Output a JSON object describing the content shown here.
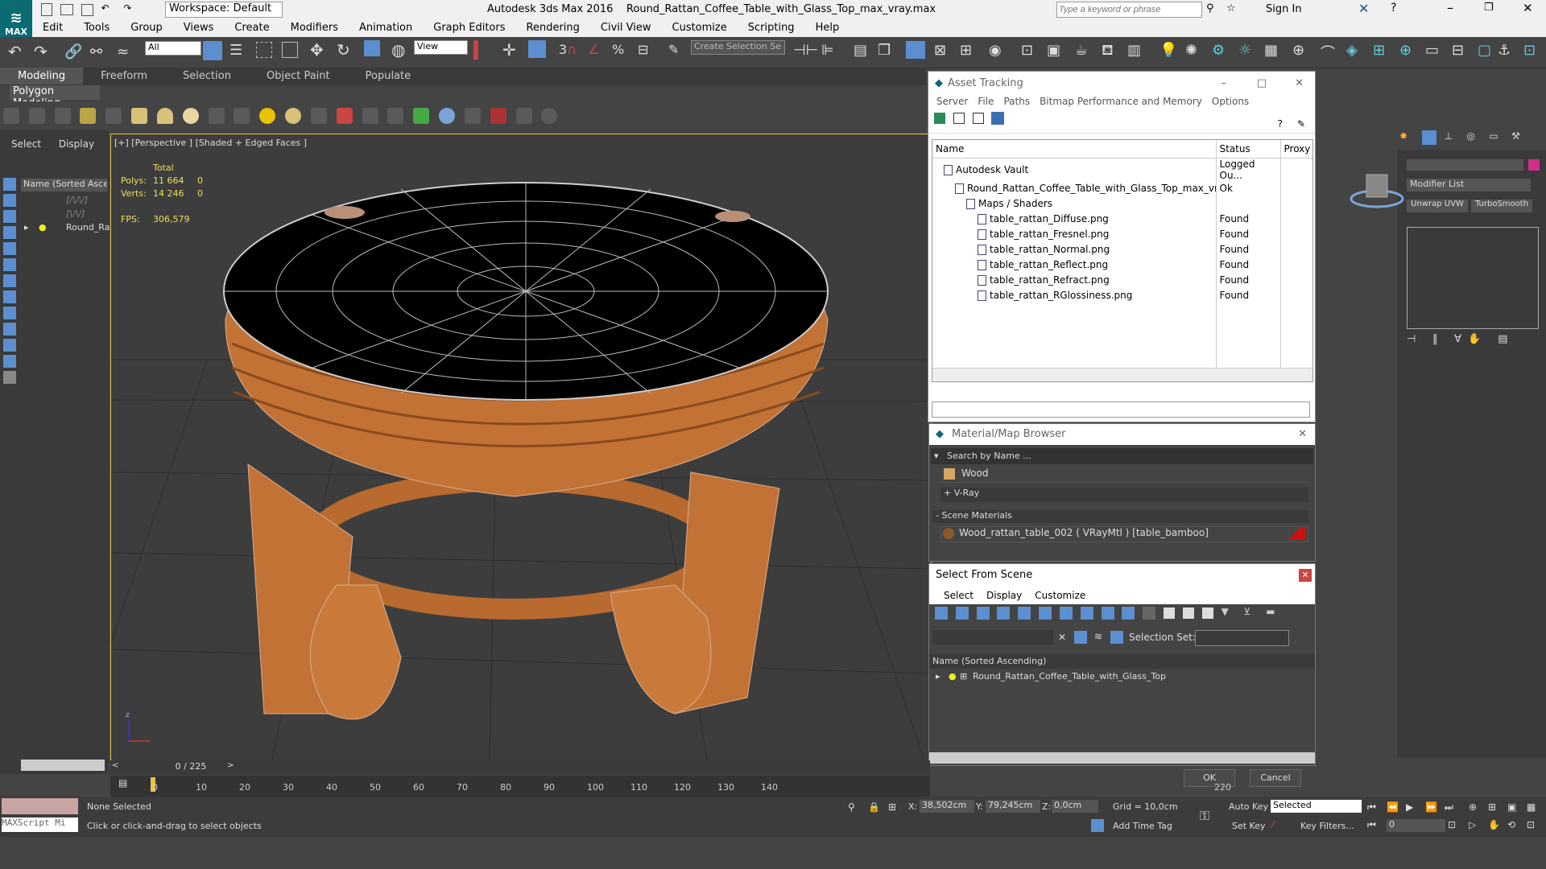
{
  "app": {
    "title": "Autodesk 3ds Max 2016",
    "file": "Round_Rattan_Coffee_Table_with_Glass_Top_max_vray.max",
    "workspace": "Workspace: Default",
    "search_placeholder": "Type a keyword or phrase",
    "sign_in": "Sign In",
    "logo_text": "MAX"
  },
  "menu": [
    "Edit",
    "Tools",
    "Group",
    "Views",
    "Create",
    "Modifiers",
    "Animation",
    "Graph Editors",
    "Rendering",
    "Civil View",
    "Customize",
    "Scripting",
    "Help"
  ],
  "toolbar": {
    "filter_all": "All",
    "view_dropdown": "View",
    "selection_set_placeholder": "Create Selection Se"
  },
  "ribbon": {
    "tabs": [
      "Modeling",
      "Freeform",
      "Selection",
      "Object Paint",
      "Populate"
    ],
    "active": "Modeling",
    "sub": "Polygon Modeling"
  },
  "scene_explorer": {
    "tabs": [
      "Select",
      "Display"
    ],
    "column": "Name (Sorted Ascen",
    "items": [
      "[/\\/\\/]",
      "[\\/\\/]",
      "Round_Ra"
    ]
  },
  "viewport": {
    "label": "[+] [Perspective ] [Shaded + Edged Faces ]",
    "stats": {
      "total_label": "Total",
      "polys_label": "Polys:",
      "polys": "11 664",
      "polys_sel": "0",
      "verts_label": "Verts:",
      "verts": "14 246",
      "verts_sel": "0",
      "fps_label": "FPS:",
      "fps": "306,579"
    }
  },
  "asset_tracking": {
    "title": "Asset Tracking",
    "menu": [
      "Server",
      "File",
      "Paths",
      "Bitmap Performance and Memory",
      "Options"
    ],
    "columns": [
      "Name",
      "Status",
      "Proxy S"
    ],
    "rows": [
      {
        "name": "Autodesk Vault",
        "status": "Logged Ou...",
        "indent": 1
      },
      {
        "name": "Round_Rattan_Coffee_Table_with_Glass_Top_max_vra...",
        "status": "Ok",
        "indent": 2
      },
      {
        "name": "Maps / Shaders",
        "status": "",
        "indent": 3
      },
      {
        "name": "table_rattan_Diffuse.png",
        "status": "Found",
        "indent": 4
      },
      {
        "name": "table_rattan_Fresnel.png",
        "status": "Found",
        "indent": 4
      },
      {
        "name": "table_rattan_Normal.png",
        "status": "Found",
        "indent": 4
      },
      {
        "name": "table_rattan_Reflect.png",
        "status": "Found",
        "indent": 4
      },
      {
        "name": "table_rattan_Refract.png",
        "status": "Found",
        "indent": 4
      },
      {
        "name": "table_rattan_RGlossiness.png",
        "status": "Found",
        "indent": 4
      }
    ]
  },
  "material_browser": {
    "title": "Material/Map Browser",
    "search": "Search by Name ...",
    "wood": "Wood",
    "vray": "+ V-Ray",
    "scene_materials": "- Scene Materials",
    "material": "Wood_rattan_table_002 ( VRayMtl ) [table_bamboo]"
  },
  "select_from_scene": {
    "title": "Select From Scene",
    "menu": [
      "Select",
      "Display",
      "Customize"
    ],
    "selection_set_label": "Selection Set:",
    "column": "Name (Sorted Ascending)",
    "item": "Round_Rattan_Coffee_Table_with_Glass_Top",
    "ok": "OK",
    "cancel": "Cancel"
  },
  "command_panel": {
    "modifier_list": "Modifier List",
    "btn1": "Unwrap UVW",
    "btn2": "TurboSmooth"
  },
  "timeline": {
    "frame": "0 / 225",
    "ticks": [
      "0",
      "10",
      "20",
      "30",
      "40",
      "50",
      "60",
      "70",
      "80",
      "90",
      "100",
      "110",
      "120",
      "130",
      "140",
      "220"
    ]
  },
  "status": {
    "none_selected": "None Selected",
    "hint": "Click or click-and-drag to select objects",
    "x_label": "X:",
    "x": "38,502cm",
    "y_label": "Y:",
    "y": "79,245cm",
    "z_label": "Z:",
    "z": "0,0cm",
    "grid": "Grid = 10,0cm",
    "add_time_tag": "Add Time Tag",
    "auto_key": "Auto Key",
    "set_key": "Set Key",
    "selected": "Selected",
    "key_filters": "Key Filters...",
    "frame_field": "0",
    "maxscript": "MAXScript Mi"
  }
}
